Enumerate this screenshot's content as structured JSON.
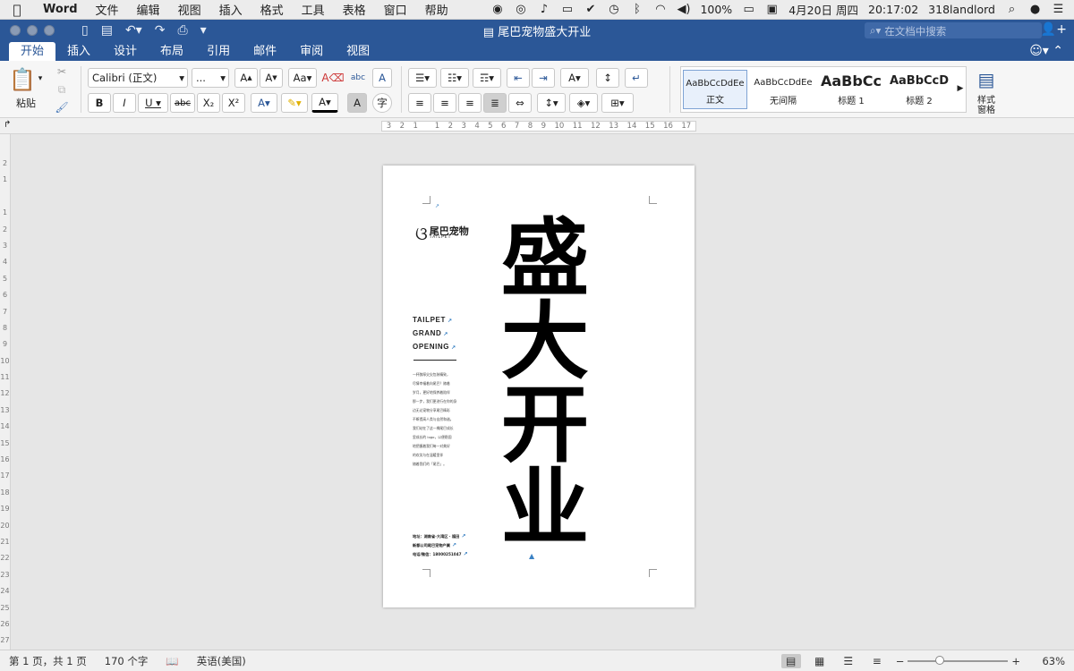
{
  "menubar": {
    "app_name": "Word",
    "items": [
      "文件",
      "编辑",
      "视图",
      "插入",
      "格式",
      "工具",
      "表格",
      "窗口",
      "帮助"
    ],
    "battery": "100%",
    "date": "4月20日 周四",
    "time": "20:17:02",
    "user": "318landlord"
  },
  "window": {
    "title": "尾巴宠物盛大开业",
    "search_placeholder": "在文档中搜索"
  },
  "tabs": [
    "开始",
    "插入",
    "设计",
    "布局",
    "引用",
    "邮件",
    "审阅",
    "视图"
  ],
  "ribbon": {
    "paste_label": "粘贴",
    "font_name": "Calibri (正文)",
    "font_size": "...",
    "bold": "B",
    "italic": "I",
    "underline": "U",
    "strikethrough": "abc",
    "subscript": "X₂",
    "superscript": "X²",
    "grow_font": "A",
    "shrink_font": "A",
    "change_case": "Aa",
    "styles": [
      {
        "preview": "AaBbCcDdEe",
        "name": "正文"
      },
      {
        "preview": "AaBbCcDdEe",
        "name": "无间隔"
      },
      {
        "preview": "AaBbCc",
        "name": "标题 1"
      },
      {
        "preview": "AaBbCcD",
        "name": "标题 2"
      }
    ],
    "styles_pane": "样式\n窗格"
  },
  "ruler": {
    "ticks": [
      "3",
      "2",
      "1",
      "",
      "1",
      "2",
      "3",
      "4",
      "5",
      "6",
      "7",
      "8",
      "9",
      "10",
      "11",
      "12",
      "13",
      "14",
      "15",
      "16",
      "17"
    ],
    "vticks": [
      "2",
      "1",
      "",
      "1",
      "2",
      "3",
      "4",
      "5",
      "6",
      "7",
      "8",
      "9",
      "10",
      "11",
      "12",
      "13",
      "14",
      "15",
      "16",
      "17",
      "18",
      "19",
      "20",
      "21",
      "22",
      "23",
      "24",
      "25",
      "26",
      "27"
    ]
  },
  "document": {
    "logo_text": "尾巴宠物",
    "logo_sub": "TAILPET",
    "heading_lines": [
      "TAILPET",
      "GRAND",
      "OPENING"
    ],
    "paragraph": "一杯醇厚尖尖包装精致，\n尽情幸福着向尾巴？随着\n岁月，更好地保养着陪伴\n那一步，我们更进行在你的身\n边无论宠物分享尾巴精彩\n不断提高人类与自然和谐。\n我们站在了这一棵尾巴成长\n里成长的 logo，以便稳固\n地把握着我们每一对美好\n的欢笑与在温暖里伴\n随着我们的「尾巴」。",
    "contact_lines": [
      "地址：湖南省-大湾区 · 福田",
      "新都公司尾巴宠物产業",
      "电话/微信：18000251047"
    ],
    "big_title_chars": [
      "盛",
      "大",
      "开",
      "业"
    ]
  },
  "statusbar": {
    "page": "第 1 页，共 1 页",
    "words": "170 个字",
    "language": "英语(美国)",
    "zoom": "63%",
    "zoom_fraction": 0.63
  },
  "colors": {
    "titlebar": "#2b5797",
    "anchor": "#3b82c4"
  }
}
